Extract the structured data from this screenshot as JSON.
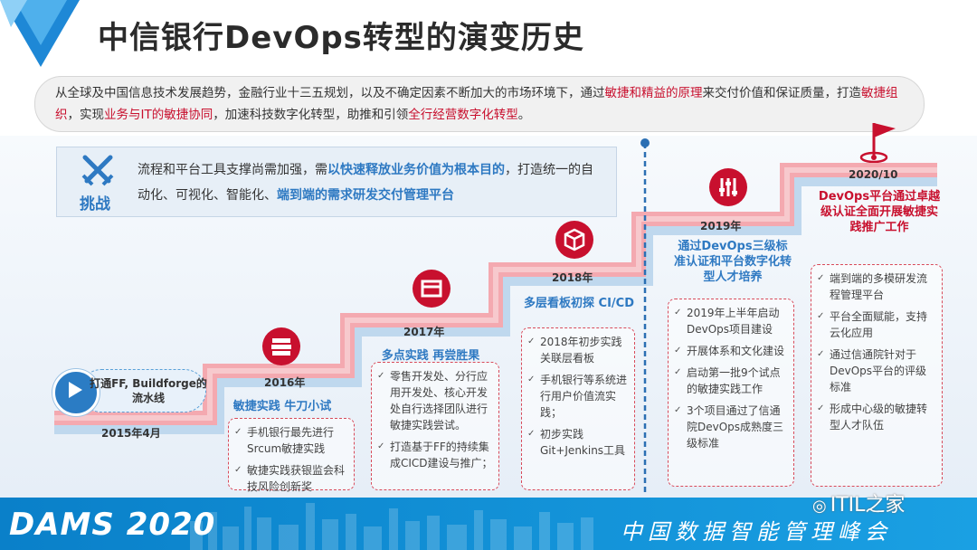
{
  "title": "中信银行DevOps转型的演变历史",
  "intro": {
    "p1": "从全球及中国信息技术发展趋势，金融行业十三五规划，以及不确定因素不断加大的市场环境下，通过",
    "r1": "敏捷和精益的原理",
    "p2": "来交付价值和保证质量，打造",
    "r2": "敏捷组织",
    "p3": "，实现",
    "r3": "业务与IT的敏捷协同",
    "p4": "，加速科技数字化转型，助推和引领",
    "r4": "全行经营数字化转型",
    "p5": "。"
  },
  "challenge": {
    "title": "挑战",
    "t1": "流程和平台工具支撑尚需加强，需",
    "b1": "以快速释放业务价值为根本目的",
    "t2": "，打造统一的自动化、可视化、智能化、",
    "b2": "端到端的需求研发交付管理平台"
  },
  "stages": {
    "s2015": {
      "year": "2015年4月",
      "desc": "打通FF, Buildforge的流水线"
    },
    "s2016": {
      "year": "2016年",
      "title": "敏捷实践 牛刀小试",
      "items": [
        "手机银行最先进行Srcum敏捷实践",
        "敏捷实践获银监会科技风险创新奖"
      ]
    },
    "s2017": {
      "year": "2017年",
      "title": "多点实践 再尝胜果",
      "items": [
        "零售开发处、分行应用开发处、核心开发处自行选择团队进行敏捷实践尝试。",
        "打造基于FF的持续集成CICD建设与推广；"
      ]
    },
    "s2018": {
      "year": "2018年",
      "title": "多层看板初探 CI/CD",
      "items": [
        "2018年初步实践关联层看板",
        "手机银行等系统进行用户价值流实践；",
        "初步实践Git+Jenkins工具"
      ]
    },
    "s2019": {
      "year": "2019年",
      "title": "通过DevOps三级标准认证和平台数字化转型人才培养",
      "items": [
        "2019年上半年启动DevOps项目建设",
        "开展体系和文化建设",
        "启动第一批9个试点的敏捷实践工作",
        "3个项目通过了信通院DevOps成熟度三级标准"
      ]
    },
    "s2020": {
      "year": "2020/10",
      "title": "DevOps平台通过卓越级认证全面开展敏捷实践推广工作",
      "items": [
        "端到端的多模研发流程管理平台",
        "平台全面赋能，支持云化应用",
        "通过信通院针对于DevOps平台的评级标准",
        "形成中心级的敏捷转型人才队伍"
      ]
    }
  },
  "footer": {
    "dams": "DAMS 2020",
    "conference": "中国数据智能管理峰会",
    "watermark": "ITIL之家"
  },
  "colors": {
    "blue": "#2e79c2",
    "red": "#c8102e",
    "band_pink": "#f4a9b0",
    "band_blue": "#bfd8ee",
    "footer": "#1493d6"
  },
  "icons": [
    "triangle-logo-icon",
    "swords-icon",
    "play-icon",
    "books-icon",
    "archive-box-icon",
    "cube-icon",
    "equalizer-icon",
    "flag-icon"
  ]
}
